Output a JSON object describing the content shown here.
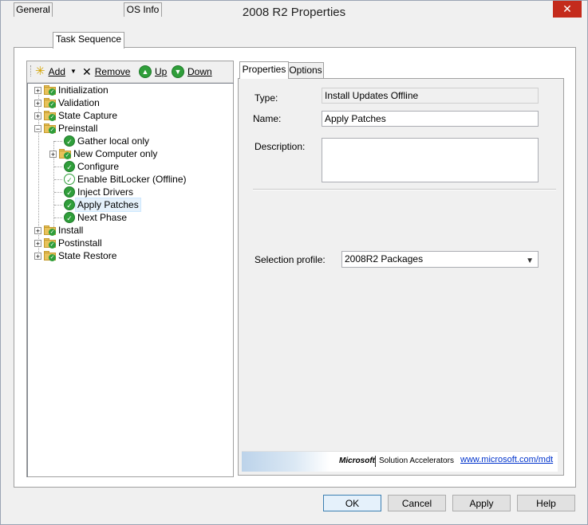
{
  "window": {
    "title": "2008 R2 Properties",
    "close_glyph": "✕"
  },
  "outer_tabs": [
    {
      "label": "General"
    },
    {
      "label": "Task Sequence"
    },
    {
      "label": "OS Info"
    }
  ],
  "toolbar": {
    "add_label": "Add",
    "remove_label": "Remove",
    "up_label": "Up",
    "down_label": "Down"
  },
  "tree": {
    "top": [
      {
        "label": "Initialization"
      },
      {
        "label": "Validation"
      },
      {
        "label": "State Capture"
      },
      {
        "label": "Preinstall"
      }
    ],
    "preinstall_children": [
      {
        "label": "Gather local only"
      },
      {
        "label": "New Computer only"
      },
      {
        "label": "Configure"
      },
      {
        "label": "Enable BitLocker (Offline)"
      },
      {
        "label": "Inject Drivers"
      },
      {
        "label": "Apply Patches"
      },
      {
        "label": "Next Phase"
      }
    ],
    "bottom": [
      {
        "label": "Install"
      },
      {
        "label": "Postinstall"
      },
      {
        "label": "State Restore"
      }
    ]
  },
  "inner_tabs": [
    {
      "label": "Properties"
    },
    {
      "label": "Options"
    }
  ],
  "properties": {
    "type_label": "Type:",
    "type_value": "Install Updates Offline",
    "name_label": "Name:",
    "name_value": "Apply Patches",
    "description_label": "Description:",
    "description_value": "",
    "selection_profile_label": "Selection profile:",
    "selection_profile_value": "2008R2 Packages"
  },
  "banner": {
    "brand": "Microsoft",
    "product": "Solution Accelerators",
    "link": "www.microsoft.com/mdt"
  },
  "buttons": {
    "ok": "OK",
    "cancel": "Cancel",
    "apply": "Apply",
    "help": "Help"
  },
  "colors": {
    "accent_green": "#2f9e3a",
    "close_red": "#c42b1c",
    "folder_yellow": "#e8c25a",
    "selection": "#e5f1fb"
  }
}
